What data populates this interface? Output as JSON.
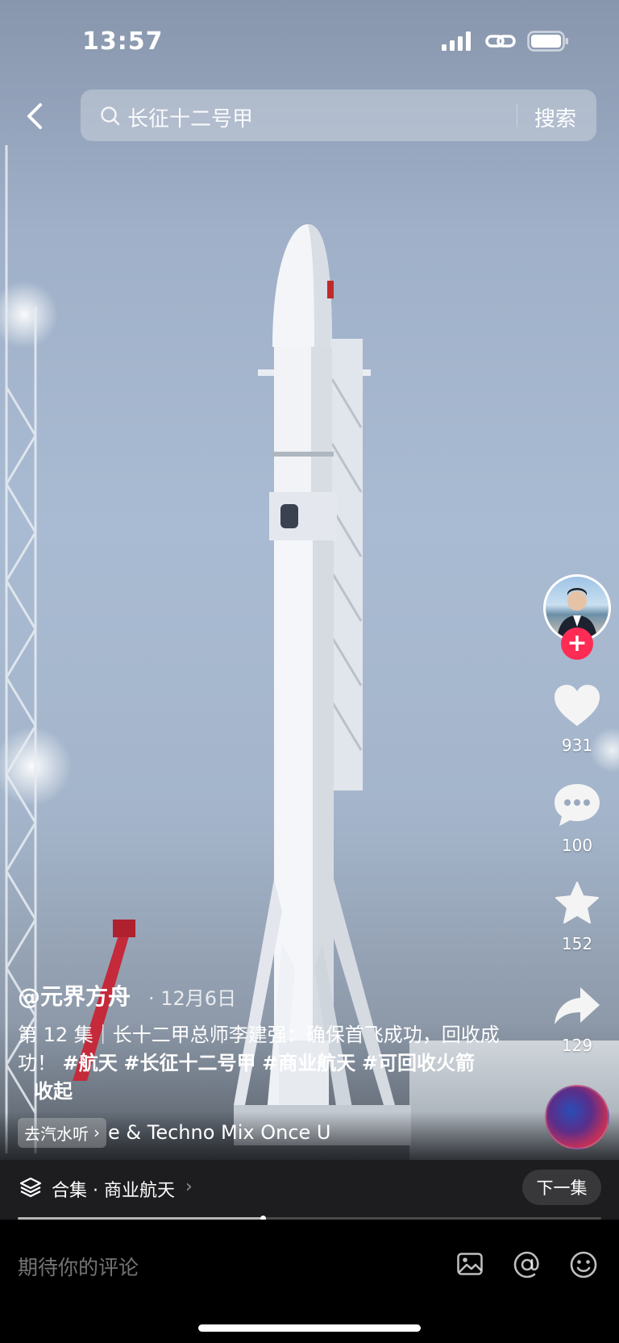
{
  "status_bar": {
    "time": "13:57"
  },
  "search": {
    "query": "长征十二号甲",
    "submit_label": "搜索"
  },
  "rail": {
    "likes": "931",
    "comments": "100",
    "favorites": "152",
    "shares": "129"
  },
  "post": {
    "author": "@元界方舟",
    "date": "· 12月6日",
    "caption_text": "第 12 集｜长十二甲总师李建强：确保首飞成功，回收成功！",
    "hashtags": [
      "#航天",
      "#长征十二号甲",
      "#商业航天",
      "#可回收火箭"
    ],
    "collapse_label": "收起",
    "soda_label": "去汽水听",
    "music_title": "e & Techno Mix    Once U"
  },
  "collection": {
    "label": "合集 · 商业航天",
    "next_label": "下一集"
  },
  "playback": {
    "progress_fraction": 0.42
  },
  "comment": {
    "placeholder": "期待你的评论"
  },
  "colors": {
    "accent": "#fe2c55",
    "bar_bg": "#1d1d1f"
  },
  "icons": [
    "back-arrow-icon",
    "search-icon",
    "heart-icon",
    "comment-icon",
    "star-icon",
    "share-icon",
    "layers-icon",
    "image-icon",
    "at-icon",
    "emoji-icon",
    "signal-icon",
    "link-icon",
    "battery-icon"
  ]
}
